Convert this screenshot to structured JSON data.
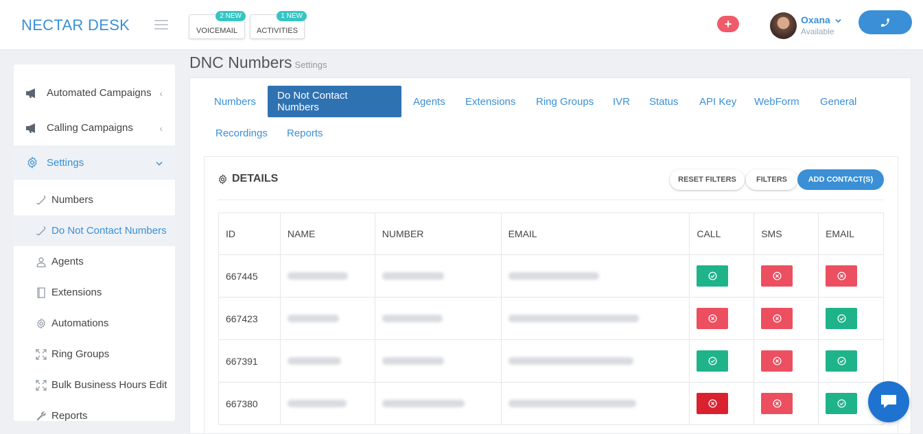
{
  "header": {
    "logo": "NECTAR DESK",
    "voicemail_label": "VOICEMAIL",
    "voicemail_badge": "2 NEW",
    "activities_label": "ACTIVITIES",
    "activities_badge": "1 NEW",
    "add_icon": "plus-icon",
    "user_name": "Oxana",
    "user_status": "Available",
    "call_icon": "phone-icon"
  },
  "sidebar": {
    "items": [
      {
        "label": "Automated Campaigns",
        "icon": "megaphone-icon"
      },
      {
        "label": "Calling Campaigns",
        "icon": "megaphone-icon"
      },
      {
        "label": "Settings",
        "icon": "gear-icon"
      }
    ],
    "sub_items": [
      {
        "label": "Numbers",
        "icon": "phone-handset-icon"
      },
      {
        "label": "Do Not Contact Numbers",
        "icon": "phone-handset-icon"
      },
      {
        "label": "Agents",
        "icon": "users-icon"
      },
      {
        "label": "Extensions",
        "icon": "book-icon"
      },
      {
        "label": "Automations",
        "icon": "gear-icon"
      },
      {
        "label": "Ring Groups",
        "icon": "expand-icon"
      },
      {
        "label": "Bulk Business Hours Edit",
        "icon": "expand-icon"
      },
      {
        "label": "Reports",
        "icon": "wrench-icon"
      }
    ]
  },
  "page": {
    "title": "DNC Numbers",
    "subtitle": "Settings"
  },
  "tabs": [
    "Numbers",
    "Do Not Contact Numbers",
    "Agents",
    "Extensions",
    "Ring Groups",
    "IVR",
    "Status",
    "API Key",
    "WebForm",
    "General",
    "Recordings",
    "Reports"
  ],
  "card": {
    "title": "DETAILS",
    "reset_filters": "RESET FILTERS",
    "filters": "FILTERS",
    "add_contacts": "ADD CONTACT(S)"
  },
  "table": {
    "headers": [
      "ID",
      "NAME",
      "NUMBER",
      "EMAIL",
      "CALL",
      "SMS",
      "EMAIL"
    ],
    "rows": [
      {
        "id": "667445",
        "call": "allowed",
        "sms": "blocked",
        "email": "blocked"
      },
      {
        "id": "667423",
        "call": "blocked",
        "sms": "blocked",
        "email": "allowed"
      },
      {
        "id": "667391",
        "call": "allowed",
        "sms": "blocked",
        "email": "allowed"
      },
      {
        "id": "667380",
        "call": "blocked",
        "sms": "blocked",
        "email": "allowed"
      }
    ]
  },
  "colors": {
    "brand_blue": "#3a8fd6",
    "active_tab": "#2f72b2",
    "allowed_green": "#1fb38a",
    "blocked_red": "#ec4f5f",
    "badge_teal": "#36c5c3"
  }
}
